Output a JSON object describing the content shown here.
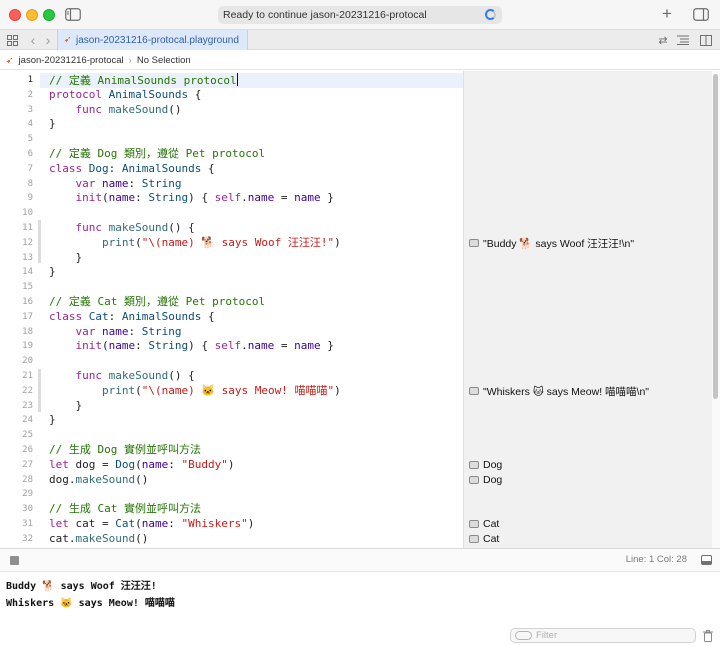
{
  "window": {
    "status_text": "Ready to continue jason-20231216-protocal"
  },
  "tab": {
    "label": "jason-20231216-protocal.playground"
  },
  "breadcrumb": {
    "project": "jason-20231216-protocal",
    "selection": "No Selection"
  },
  "editor": {
    "line_numbers": [
      "1",
      "2",
      "3",
      "4",
      "5",
      "6",
      "7",
      "8",
      "9",
      "10",
      "11",
      "12",
      "13",
      "14",
      "15",
      "16",
      "17",
      "18",
      "19",
      "20",
      "21",
      "22",
      "23",
      "24",
      "25",
      "26",
      "27",
      "28",
      "29",
      "30",
      "31",
      "32"
    ],
    "current_line": "1"
  },
  "results": [
    {
      "line": 12,
      "text": "\"Buddy 🐕 says Woof 汪汪汪!\\n\""
    },
    {
      "line": 22,
      "text": "\"Whiskers 🐱 says Meow! 喵喵喵\\n\""
    },
    {
      "line": 27,
      "text": "Dog"
    },
    {
      "line": 28,
      "text": "Dog"
    },
    {
      "line": 31,
      "text": "Cat"
    },
    {
      "line": 32,
      "text": "Cat"
    }
  ],
  "statusbar": {
    "position": "Line: 1  Col: 28"
  },
  "console": {
    "lines": [
      "Buddy 🐕 says Woof 汪汪汪!",
      "Whiskers 🐱 says Meow! 喵喵喵"
    ],
    "filter_placeholder": "Filter"
  },
  "colors": {
    "keyword": "#9b2393",
    "type": "#0b4f79",
    "comment": "#267507",
    "string": "#c41a16",
    "accent": "#2f7cf6"
  },
  "code": [
    "// 定義 AnimalSounds protocol",
    "protocol AnimalSounds {",
    "    func makeSound()",
    "}",
    "",
    "// 定義 Dog 類別，遵從 Pet protocol",
    "class Dog: AnimalSounds {",
    "    var name: String",
    "    init(name: String) { self.name = name }",
    "",
    "    func makeSound() {",
    "        print(\"\\(name) 🐕 says Woof 汪汪汪!\")",
    "    }",
    "}",
    "",
    "// 定義 Cat 類別，遵從 Pet protocol",
    "class Cat: AnimalSounds {",
    "    var name: String",
    "    init(name: String) { self.name = name }",
    "",
    "    func makeSound() {",
    "        print(\"\\(name) 🐱 says Meow! 喵喵喵\")",
    "    }",
    "}",
    "",
    "// 生成 Dog 實例並呼叫方法",
    "let dog = Dog(name: \"Buddy\")",
    "dog.makeSound()",
    "",
    "// 生成 Cat 實例並呼叫方法",
    "let cat = Cat(name: \"Whiskers\")",
    "cat.makeSound()"
  ]
}
